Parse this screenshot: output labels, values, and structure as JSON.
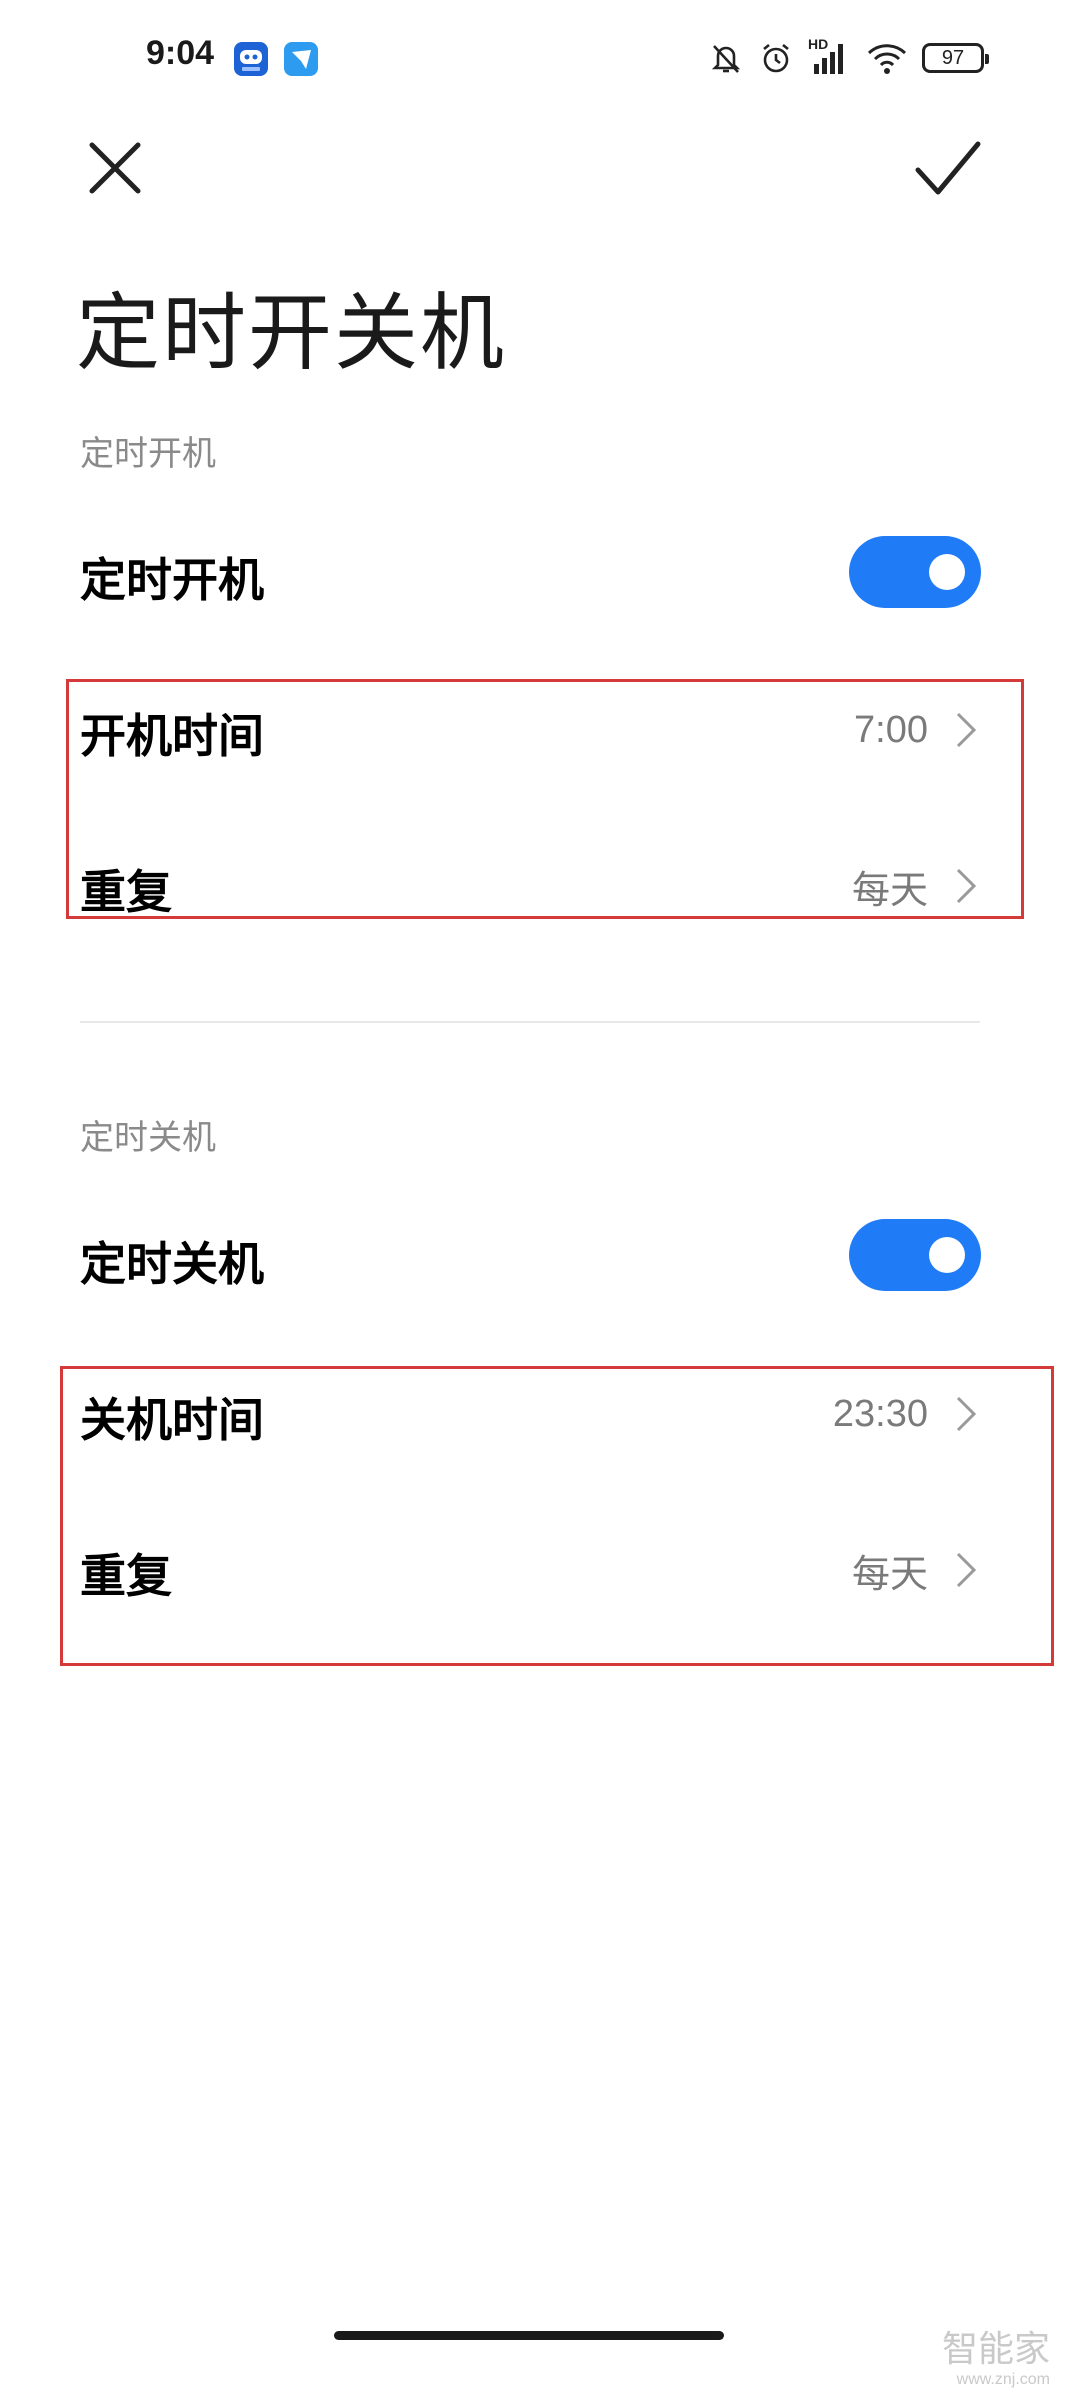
{
  "status_bar": {
    "time": "9:04",
    "battery": "97",
    "icons": [
      "app-icon-robot",
      "app-icon-plane",
      "mute-bell-icon",
      "alarm-icon",
      "hd-signal-icon",
      "wifi-icon",
      "battery-icon"
    ],
    "network_label": "HD"
  },
  "header": {
    "close_icon": "close-icon",
    "confirm_icon": "check-icon",
    "title": "定时开关机"
  },
  "power_on": {
    "section_label": "定时开机",
    "toggle_label": "定时开机",
    "toggle_on": true,
    "time_label": "开机时间",
    "time_value": "7:00",
    "repeat_label": "重复",
    "repeat_value": "每天"
  },
  "power_off": {
    "section_label": "定时关机",
    "toggle_label": "定时关机",
    "toggle_on": true,
    "time_label": "关机时间",
    "time_value": "23:30",
    "repeat_label": "重复",
    "repeat_value": "每天"
  },
  "watermark": {
    "brand": "智能家",
    "url": "www.znj.com"
  },
  "colors": {
    "accent": "#1f7cf6",
    "highlight_box": "#d43a3a",
    "secondary_text": "#8a8a8a"
  }
}
